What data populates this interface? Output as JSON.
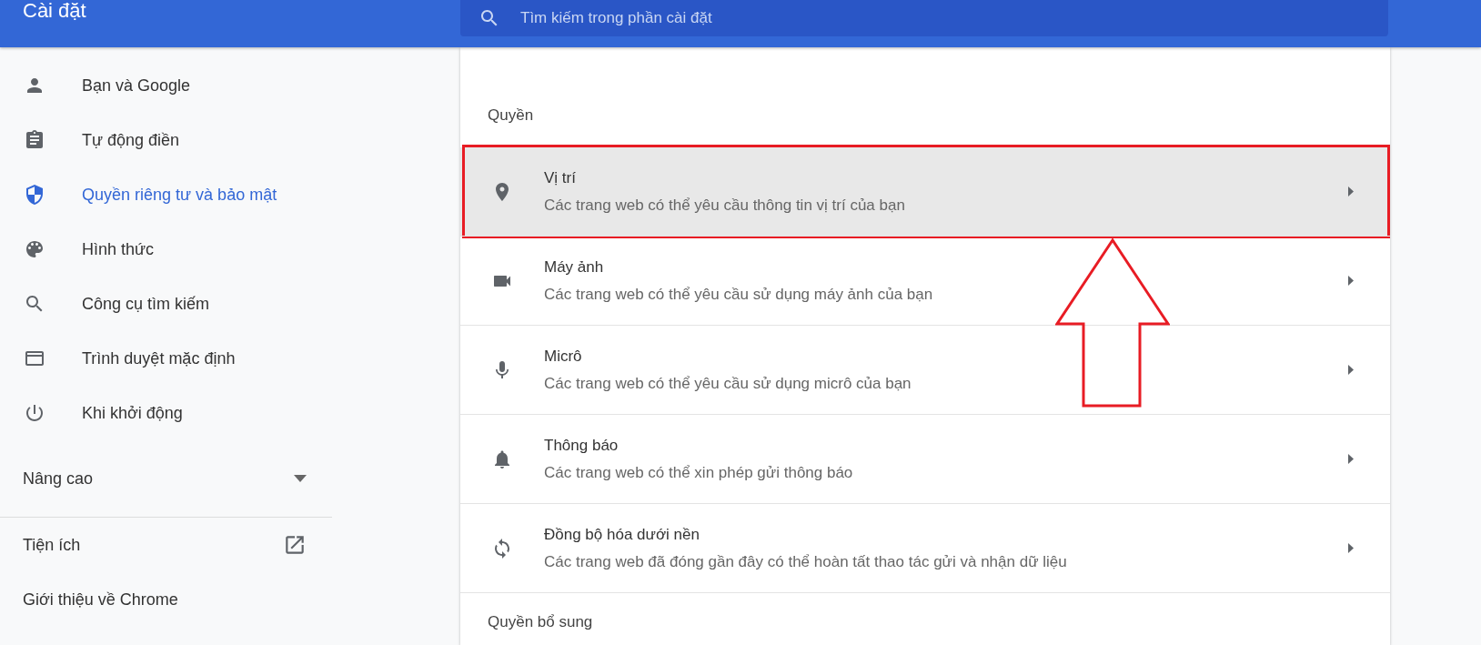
{
  "header": {
    "title": "Cài đặt",
    "search": {
      "placeholder": "Tìm kiếm trong phần cài đặt"
    }
  },
  "sidebar": {
    "items": [
      {
        "label": "Bạn và Google",
        "selected": false
      },
      {
        "label": "Tự động điền",
        "selected": false
      },
      {
        "label": "Quyền riêng tư và bảo mật",
        "selected": true
      },
      {
        "label": "Hình thức",
        "selected": false
      },
      {
        "label": "Công cụ tìm kiếm",
        "selected": false
      },
      {
        "label": "Trình duyệt mặc định",
        "selected": false
      },
      {
        "label": "Khi khởi động",
        "selected": false
      }
    ],
    "advanced": {
      "label": "Nâng cao",
      "expanded": false
    },
    "links": [
      {
        "label": "Tiện ích",
        "external": true
      },
      {
        "label": "Giới thiệu về Chrome",
        "external": false
      }
    ]
  },
  "section": {
    "title": "Quyền",
    "rows": [
      {
        "title": "Vị trí",
        "description": "Các trang web có thể yêu cầu thông tin vị trí của bạn",
        "selected": true
      },
      {
        "title": "Máy ảnh",
        "description": "Các trang web có thể yêu cầu sử dụng máy ảnh của bạn",
        "selected": false
      },
      {
        "title": "Micrô",
        "description": "Các trang web có thể yêu cầu sử dụng micrô của bạn",
        "selected": false
      },
      {
        "title": "Thông báo",
        "description": "Các trang web có thể xin phép gửi thông báo",
        "selected": false
      },
      {
        "title": "Đồng bộ hóa dưới nền",
        "description": "Các trang web đã đóng gần đây có thể hoàn tất thao tác gửi và nhận dữ liệu",
        "selected": false
      }
    ],
    "next_title": "Quyền bổ sung"
  }
}
